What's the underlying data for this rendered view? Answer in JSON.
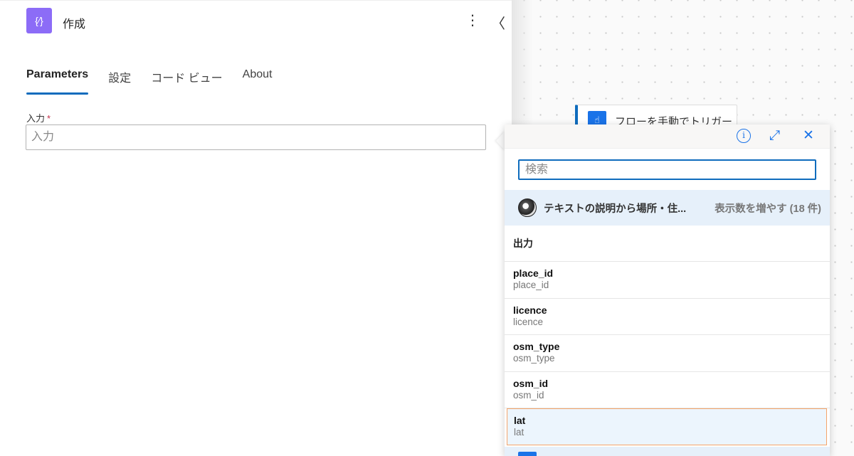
{
  "panel": {
    "title": "作成",
    "app_icon": "{⁄}",
    "tabs": [
      "Parameters",
      "設定",
      "コード ビュー",
      "About"
    ],
    "field_label": "入力",
    "required_mark": "*",
    "field_placeholder": "入力"
  },
  "canvas": {
    "trigger_label": "フローを手動でトリガー"
  },
  "popup": {
    "search_placeholder": "検索",
    "group_name": "テキストの説明から場所・住...",
    "group_more": "表示数を増やす (18 件)",
    "section": "出力",
    "items": [
      {
        "name": "place_id",
        "desc": "place_id"
      },
      {
        "name": "licence",
        "desc": "licence"
      },
      {
        "name": "osm_type",
        "desc": "osm_type"
      },
      {
        "name": "osm_id",
        "desc": "osm_id"
      },
      {
        "name": "lat",
        "desc": "lat"
      }
    ]
  },
  "colors": {
    "accent": "#0f6cbd",
    "app_icon": "#8c6cf7",
    "selected_border": "#f4a46a"
  }
}
